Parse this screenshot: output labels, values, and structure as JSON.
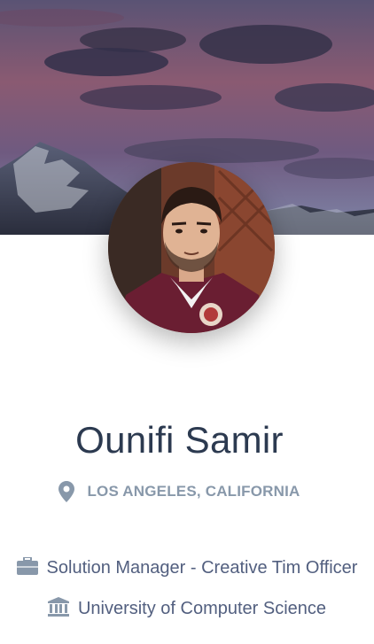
{
  "profile": {
    "name": "Ounifi Samir",
    "location": "LOS ANGELES, CALIFORNIA",
    "job": "Solution Manager - Creative Tim Officer",
    "education": "University of Computer Science"
  },
  "icons": {
    "location": "map-pin-icon",
    "job": "briefcase-icon",
    "education": "university-icon"
  },
  "colors": {
    "name": "#2c3a50",
    "muted": "#8898aa",
    "body_text": "#525f7f",
    "icon": "#8898aa"
  }
}
